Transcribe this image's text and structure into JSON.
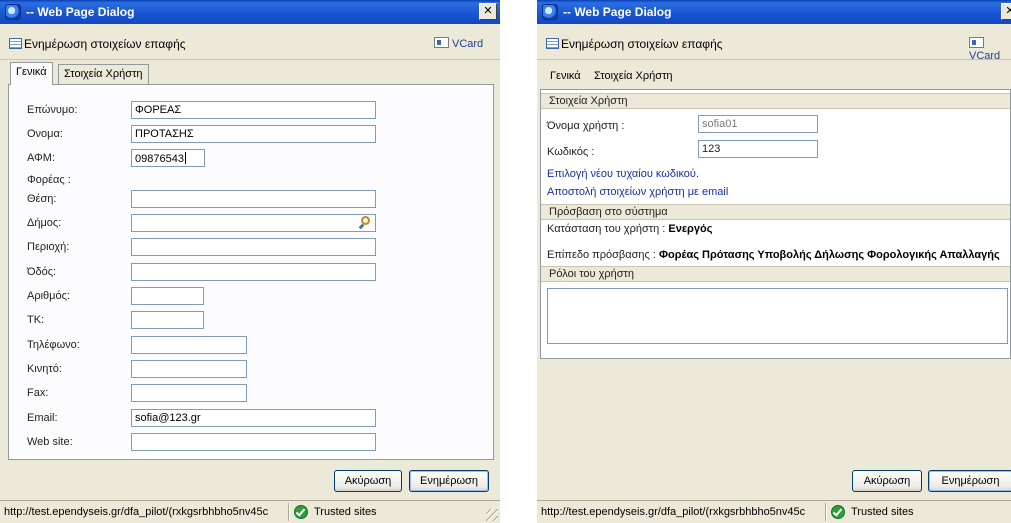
{
  "left_dialog": {
    "title": "-- Web Page Dialog",
    "close_glyph": "✕",
    "header_title": "Ενημέρωση στοιχείων επαφής",
    "vcard_label": "VCard",
    "tabs": [
      "Γενικά",
      "Στοιχεία Χρήστη"
    ],
    "active_tab": "Γενικά",
    "fields": [
      {
        "label": "Επώνυμο:",
        "value": "ΦΟΡΕΑΣ"
      },
      {
        "label": "Ονομα:",
        "value": "ΠΡΟΤΑΣΗΣ"
      },
      {
        "label": "ΑΦΜ:",
        "value": "09876543"
      },
      {
        "label": "Φορέας :",
        "value": ""
      },
      {
        "label": "Θέση:",
        "value": ""
      },
      {
        "label": "Δήμος:",
        "value": ""
      },
      {
        "label": "Περιοχή:",
        "value": ""
      },
      {
        "label": "Όδός:",
        "value": ""
      },
      {
        "label": "Αριθμός:",
        "value": ""
      },
      {
        "label": "ΤΚ:",
        "value": ""
      },
      {
        "label": "Τηλέφωνο:",
        "value": ""
      },
      {
        "label": "Κινητό:",
        "value": ""
      },
      {
        "label": "Fax:",
        "value": ""
      },
      {
        "label": "Email:",
        "value": "sofia@123.gr"
      },
      {
        "label": "Web site:",
        "value": ""
      }
    ],
    "cancel_label": "Ακύρωση",
    "update_label": "Ενημέρωση",
    "status_url": "http://test.ependyseis.gr/dfa_pilot/(rxkgsrbhbho5nv45c",
    "status_zone": "Trusted sites"
  },
  "right_dialog": {
    "title": "-- Web Page Dialog",
    "close_glyph": "✕",
    "header_title": "Ενημέρωση στοιχείων επαφής",
    "vcard_label": "VCard",
    "tabs": [
      "Γενικά",
      "Στοιχεία Χρήστη"
    ],
    "active_tab": "Στοιχεία Χρήστη",
    "user_section_title": "Στοιχεία Χρήστη",
    "username_label": "Όνομα χρήστη :",
    "username_value": "sofia01",
    "password_label": "Κωδικός :",
    "password_value": "123",
    "random_password_link": "Επιλογή νέου τυχαίου κωδικού.",
    "email_credentials_link": "Αποστολή στοιχείων χρήστη με email",
    "access_section_title": "Πρόσβαση στο σύστημα",
    "status_label": "Κατάσταση του χρήστη :",
    "status_value": "Ενεργός",
    "access_level_label": "Επίπεδο πρόσβασης :",
    "access_level_value": "Φορέας Πρότασης Υποβολής Δήλωσης Φορολογικής Απαλλαγής",
    "roles_section_title": "Ρόλοι του χρήστη",
    "cancel_label": "Ακύρωση",
    "update_label": "Ενημέρωση",
    "status_url": "http://test.ependyseis.gr/dfa_pilot/(rxkgsrbhbho5nv45c",
    "status_zone": "Trusted sites"
  }
}
